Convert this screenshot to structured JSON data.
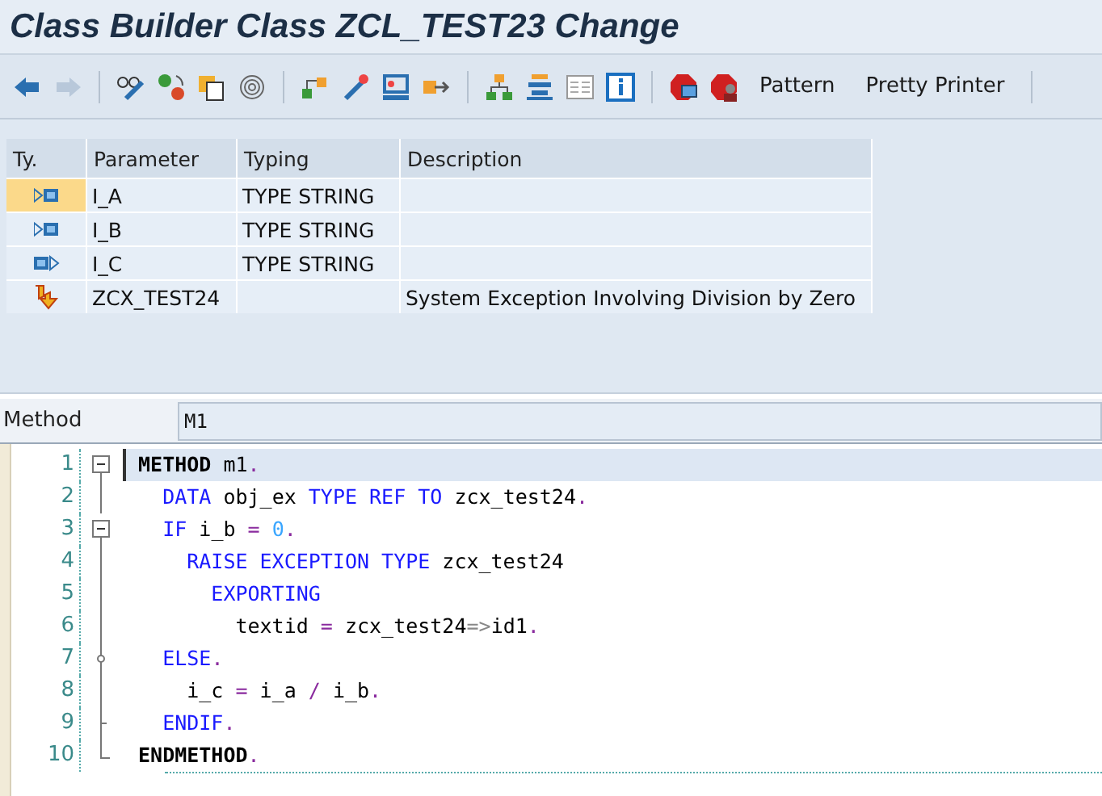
{
  "window": {
    "title": "Class Builder Class ZCL_TEST23 Change"
  },
  "toolbar": [
    {
      "kind": "back",
      "disabled": false
    },
    {
      "kind": "forward",
      "disabled": true
    },
    {
      "kind": "sep"
    },
    {
      "kind": "glasses"
    },
    {
      "kind": "swap"
    },
    {
      "kind": "pages"
    },
    {
      "kind": "spiral"
    },
    {
      "kind": "sep"
    },
    {
      "kind": "nodes"
    },
    {
      "kind": "wand"
    },
    {
      "kind": "screen"
    },
    {
      "kind": "export"
    },
    {
      "kind": "sep"
    },
    {
      "kind": "tree"
    },
    {
      "kind": "stack"
    },
    {
      "kind": "list"
    },
    {
      "kind": "info"
    },
    {
      "kind": "sep"
    },
    {
      "kind": "stopscreen"
    },
    {
      "kind": "stopperson"
    },
    {
      "kind": "text",
      "label": "Pattern"
    },
    {
      "kind": "text",
      "label": "Pretty Printer"
    },
    {
      "kind": "sep"
    }
  ],
  "params": {
    "columns": [
      "Ty.",
      "Parameter",
      "Typing",
      "Description"
    ],
    "rows": [
      {
        "kind": "importing",
        "selected": true,
        "name": "I_A",
        "typing": "TYPE STRING",
        "description": ""
      },
      {
        "kind": "importing",
        "selected": false,
        "name": "I_B",
        "typing": "TYPE STRING",
        "description": ""
      },
      {
        "kind": "exporting",
        "selected": false,
        "name": "I_C",
        "typing": "TYPE STRING",
        "description": ""
      },
      {
        "kind": "exception",
        "selected": false,
        "name": "ZCX_TEST24",
        "typing": "",
        "description": "System Exception Involving Division by Zero"
      }
    ]
  },
  "method": {
    "label": "Method",
    "value": "M1"
  },
  "code": [
    {
      "number": "1",
      "current": true,
      "fold": {
        "kind": "open"
      },
      "tokens": [
        {
          "kind": "bold",
          "text": " METHOD"
        },
        {
          "kind": "plain",
          "text": " m1"
        },
        {
          "kind": "operator",
          "text": "."
        }
      ]
    },
    {
      "number": "2",
      "current": false,
      "fold": {
        "kind": "line"
      },
      "tokens": [
        {
          "kind": "keyword",
          "text": "   DATA"
        },
        {
          "kind": "plain",
          "text": " obj_ex "
        },
        {
          "kind": "keyword",
          "text": "TYPE REF TO"
        },
        {
          "kind": "plain",
          "text": " zcx_test24"
        },
        {
          "kind": "operator",
          "text": "."
        }
      ]
    },
    {
      "number": "3",
      "current": false,
      "fold": {
        "kind": "open"
      },
      "tokens": [
        {
          "kind": "keyword",
          "text": "   IF"
        },
        {
          "kind": "plain",
          "text": " i_b "
        },
        {
          "kind": "operator",
          "text": "="
        },
        {
          "kind": "number",
          "text": " 0"
        },
        {
          "kind": "operator",
          "text": "."
        }
      ]
    },
    {
      "number": "4",
      "current": false,
      "fold": {
        "kind": "line"
      },
      "tokens": [
        {
          "kind": "keyword",
          "text": "     RAISE EXCEPTION TYPE"
        },
        {
          "kind": "plain",
          "text": " zcx_test24"
        }
      ]
    },
    {
      "number": "5",
      "current": false,
      "fold": {
        "kind": "line"
      },
      "tokens": [
        {
          "kind": "keyword",
          "text": "       EXPORTING"
        }
      ]
    },
    {
      "number": "6",
      "current": false,
      "fold": {
        "kind": "line"
      },
      "tokens": [
        {
          "kind": "plain",
          "text": "         textid "
        },
        {
          "kind": "operator",
          "text": "="
        },
        {
          "kind": "plain",
          "text": " zcx_test24"
        },
        {
          "kind": "component",
          "text": "=>"
        },
        {
          "kind": "plain",
          "text": "id1"
        },
        {
          "kind": "operator",
          "text": "."
        }
      ]
    },
    {
      "number": "7",
      "current": false,
      "fold": {
        "kind": "branch"
      },
      "tokens": [
        {
          "kind": "keyword",
          "text": "   ELSE"
        },
        {
          "kind": "operator",
          "text": "."
        }
      ]
    },
    {
      "number": "8",
      "current": false,
      "fold": {
        "kind": "line"
      },
      "tokens": [
        {
          "kind": "plain",
          "text": "     i_c "
        },
        {
          "kind": "operator",
          "text": "="
        },
        {
          "kind": "plain",
          "text": " i_a "
        },
        {
          "kind": "operator",
          "text": "/"
        },
        {
          "kind": "plain",
          "text": " i_b"
        },
        {
          "kind": "operator",
          "text": "."
        }
      ]
    },
    {
      "number": "9",
      "current": false,
      "fold": {
        "kind": "end"
      },
      "tokens": [
        {
          "kind": "keyword",
          "text": "   ENDIF"
        },
        {
          "kind": "operator",
          "text": "."
        }
      ]
    },
    {
      "number": "10",
      "current": false,
      "fold": {
        "kind": "last"
      },
      "tokens": [
        {
          "kind": "bold",
          "text": " ENDMETHOD"
        },
        {
          "kind": "operator",
          "text": "."
        }
      ]
    }
  ]
}
